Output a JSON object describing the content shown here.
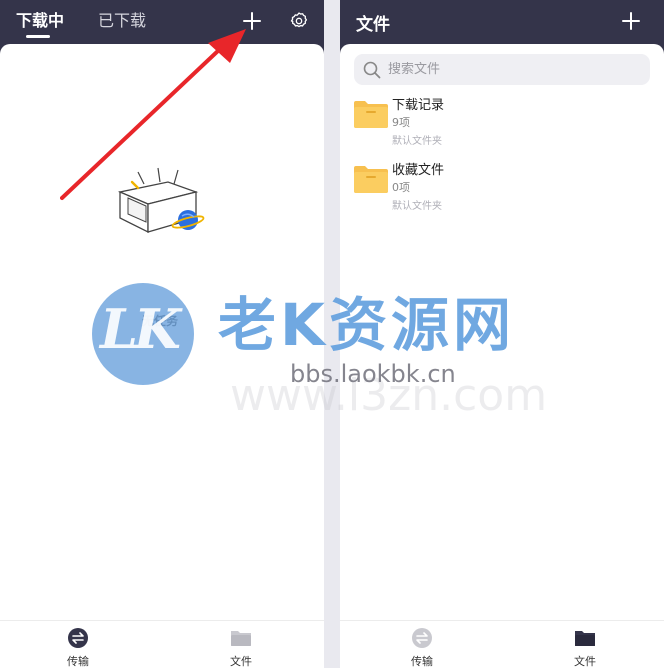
{
  "left_panel": {
    "tabs": [
      {
        "label": "下载中",
        "active": true
      },
      {
        "label": "已下载",
        "active": false
      }
    ],
    "empty_state": {
      "message": "无任务"
    },
    "bottom_nav": [
      {
        "label": "传输",
        "icon": "transfer-icon",
        "active": true
      },
      {
        "label": "文件",
        "icon": "folder-icon",
        "active": false
      }
    ]
  },
  "right_panel": {
    "title": "文件",
    "search": {
      "placeholder": "搜索文件"
    },
    "folders": [
      {
        "name": "下载记录",
        "count": "9项",
        "type": "默认文件夹"
      },
      {
        "name": "收藏文件",
        "count": "0项",
        "type": "默认文件夹"
      }
    ],
    "bottom_nav": [
      {
        "label": "传输",
        "icon": "transfer-icon",
        "active": false
      },
      {
        "label": "文件",
        "icon": "folder-icon",
        "active": true
      }
    ]
  },
  "watermark": {
    "logo_text": "LK",
    "title": "老K资源网",
    "url": "bbs.laokbk.cn",
    "faint_text": "www.l3zn.com"
  },
  "colors": {
    "header_bg": "#34344a",
    "folder_yellow": "#f7c04f",
    "accent_red": "#e8262a",
    "watermark_blue": "#609ede"
  }
}
